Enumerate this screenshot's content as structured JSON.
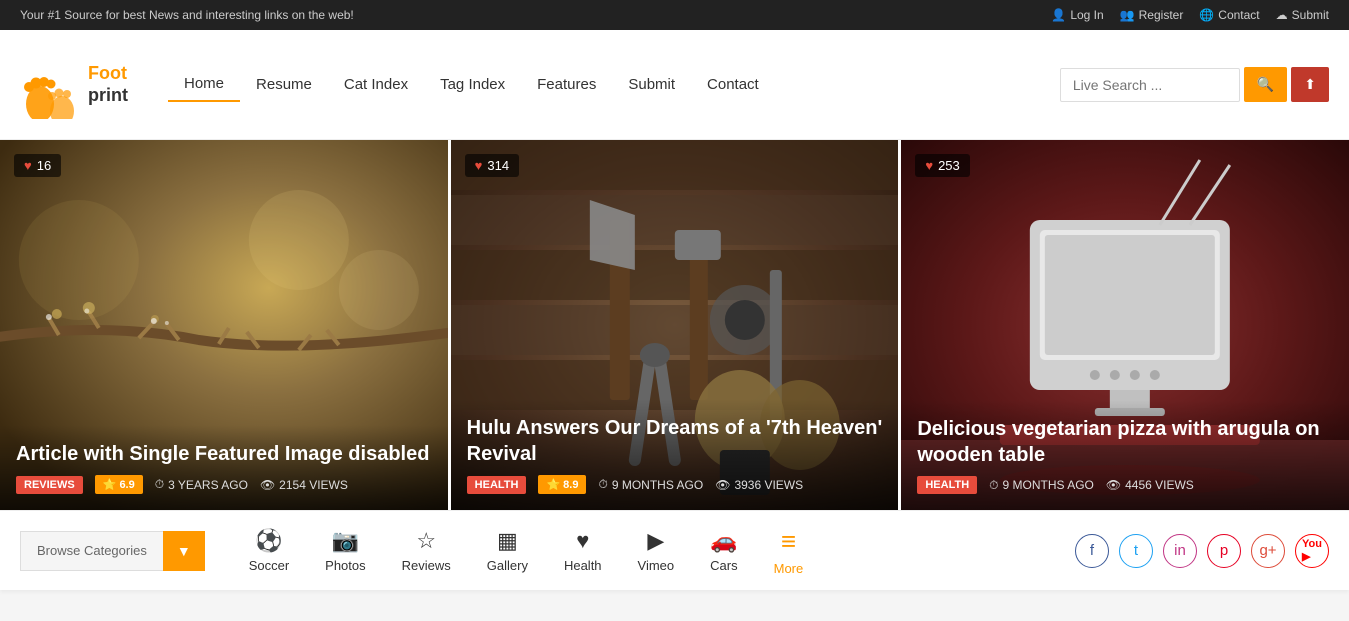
{
  "topbar": {
    "tagline": "Your #1 Source for best News and interesting links on the web!",
    "links": [
      {
        "label": "Log In",
        "icon": "user"
      },
      {
        "label": "Register",
        "icon": "user-plus"
      },
      {
        "label": "Contact",
        "icon": "globe"
      },
      {
        "label": "Submit",
        "icon": "cloud-upload"
      }
    ]
  },
  "header": {
    "logo": {
      "line1": "Foot",
      "line2": "print"
    },
    "nav": [
      {
        "label": "Home",
        "active": true
      },
      {
        "label": "Resume",
        "active": false
      },
      {
        "label": "Cat Index",
        "active": false
      },
      {
        "label": "Tag Index",
        "active": false
      },
      {
        "label": "Features",
        "active": false
      },
      {
        "label": "Submit",
        "active": false
      },
      {
        "label": "Contact",
        "active": false
      }
    ],
    "search": {
      "placeholder": "Live Search ...",
      "search_btn": "🔍",
      "upload_btn": "⬆"
    }
  },
  "cards": [
    {
      "badge_count": "16",
      "title": "Article with Single Featured Image disabled",
      "tag": "REVIEWS",
      "tag_class": "tag-reviews",
      "rating": "6.9",
      "time_ago": "3 YEARS AGO",
      "views": "2154 VIEWS",
      "bg_color": "#5d4e37"
    },
    {
      "badge_count": "314",
      "title": "Hulu Answers Our Dreams of a '7th Heaven' Revival",
      "tag": "HEALTH",
      "tag_class": "tag-health",
      "rating": "8.9",
      "time_ago": "9 MONTHS AGO",
      "views": "3936 VIEWS",
      "bg_color": "#3d2b1f"
    },
    {
      "badge_count": "253",
      "title": "Delicious vegetarian pizza with arugula on wooden table",
      "tag": "HEALTH",
      "tag_class": "tag-health",
      "rating": null,
      "time_ago": "9 MONTHS AGO",
      "views": "4456 VIEWS",
      "bg_color": "#5c2020"
    }
  ],
  "bottom": {
    "browse_label": "Browse Categories",
    "dropdown_icon": "▼",
    "categories": [
      {
        "label": "Soccer",
        "icon": "⚽",
        "active": false
      },
      {
        "label": "Photos",
        "icon": "📷",
        "active": false
      },
      {
        "label": "Reviews",
        "icon": "⭐",
        "active": false
      },
      {
        "label": "Gallery",
        "icon": "🖼",
        "active": false
      },
      {
        "label": "Health",
        "icon": "♥",
        "active": false
      },
      {
        "label": "Vimeo",
        "icon": "▶",
        "active": false
      },
      {
        "label": "Cars",
        "icon": "🚗",
        "active": false
      },
      {
        "label": "More",
        "icon": "≡",
        "active": true
      }
    ],
    "social": [
      {
        "label": "facebook",
        "icon": "f"
      },
      {
        "label": "twitter",
        "icon": "t"
      },
      {
        "label": "instagram",
        "icon": "in"
      },
      {
        "label": "pinterest",
        "icon": "p"
      },
      {
        "label": "google-plus",
        "icon": "g+"
      },
      {
        "label": "youtube",
        "icon": "▶"
      }
    ]
  }
}
